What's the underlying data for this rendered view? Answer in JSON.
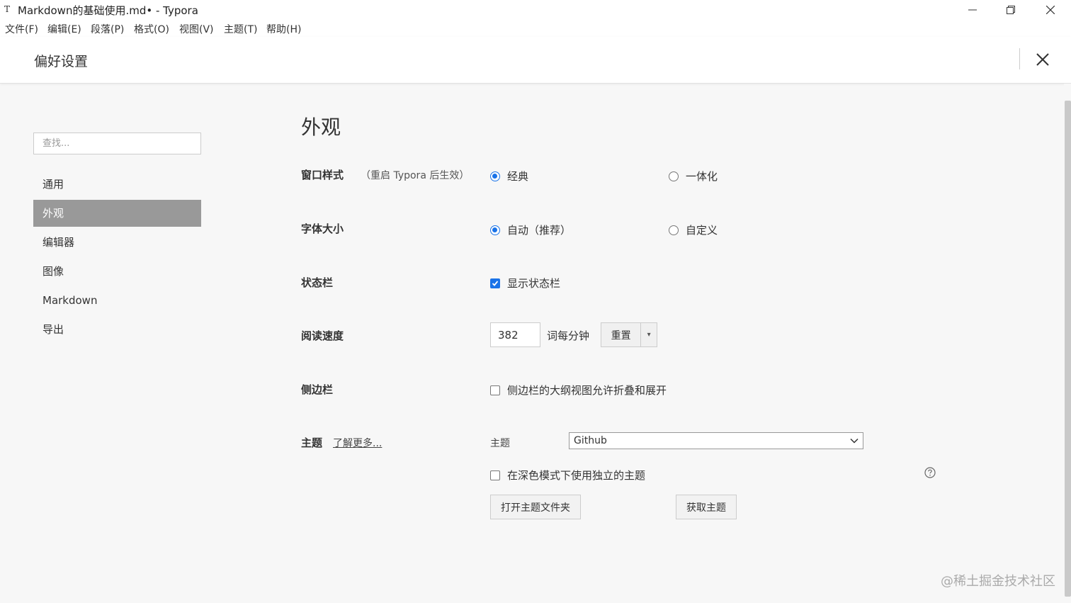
{
  "window": {
    "title": "Markdown的基础使用.md• - Typora",
    "app_icon": "T"
  },
  "menu": [
    "文件(F)",
    "编辑(E)",
    "段落(P)",
    "格式(O)",
    "视图(V)",
    "主题(T)",
    "帮助(H)"
  ],
  "prefs": {
    "title": "偏好设置"
  },
  "sidebar": {
    "search_placeholder": "查找...",
    "items": [
      {
        "label": "通用",
        "active": false
      },
      {
        "label": "外观",
        "active": true
      },
      {
        "label": "编辑器",
        "active": false
      },
      {
        "label": "图像",
        "active": false
      },
      {
        "label": "Markdown",
        "active": false
      },
      {
        "label": "导出",
        "active": false
      }
    ]
  },
  "main": {
    "section_title": "外观",
    "window_style": {
      "label": "窗口样式",
      "note": "（重启 Typora 后生效）",
      "options": [
        {
          "label": "经典",
          "selected": true
        },
        {
          "label": "一体化",
          "selected": false
        }
      ]
    },
    "font_size": {
      "label": "字体大小",
      "options": [
        {
          "label": "自动（推荐）",
          "selected": true
        },
        {
          "label": "自定义",
          "selected": false
        }
      ]
    },
    "status_bar": {
      "label": "状态栏",
      "option": {
        "label": "显示状态栏",
        "checked": true
      }
    },
    "reading_speed": {
      "label": "阅读速度",
      "value": "382",
      "unit": "词每分钟",
      "reset_label": "重置",
      "arrow": "▾"
    },
    "sidebar_opt": {
      "label": "侧边栏",
      "option": {
        "label": "侧边栏的大纲视图允许折叠和展开",
        "checked": false
      }
    },
    "theme": {
      "label": "主题",
      "learn_more": "了解更多...",
      "select_label": "主题",
      "selected": "Github",
      "dark_mode_option": {
        "label": "在深色模式下使用独立的主题",
        "checked": false
      },
      "open_folder_btn": "打开主题文件夹",
      "get_themes_btn": "获取主题"
    }
  },
  "watermark": "@稀土掘金技术社区",
  "colors": {
    "accent": "#1a73e8",
    "active_nav_bg": "#999999"
  }
}
